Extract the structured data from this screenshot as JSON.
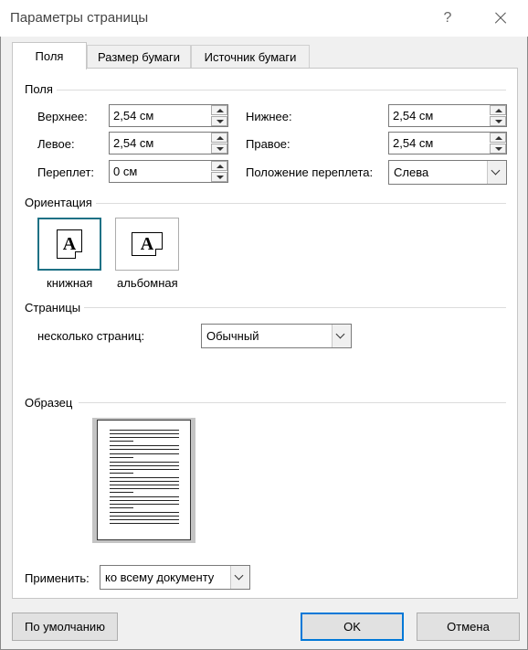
{
  "window": {
    "title": "Параметры страницы",
    "help": "?"
  },
  "tabs": [
    "Поля",
    "Размер бумаги",
    "Источник бумаги"
  ],
  "margins": {
    "group_label": "Поля",
    "top_label": "Верхнее:",
    "top_value": "2,54 см",
    "left_label": "Левое:",
    "left_value": "2,54 см",
    "gutter_label": "Переплет:",
    "gutter_value": "0 см",
    "bottom_label": "Нижнее:",
    "bottom_value": "2,54 см",
    "right_label": "Правое:",
    "right_value": "2,54 см",
    "gutter_pos_label": "Положение переплета:",
    "gutter_pos_value": "Слева"
  },
  "orientation": {
    "group_label": "Ориентация",
    "portrait_label": "книжная",
    "landscape_label": "альбомная",
    "icon_letter": "A",
    "selected": "portrait"
  },
  "pages": {
    "group_label": "Страницы",
    "multiple_label": "несколько страниц:",
    "multiple_value": "Обычный"
  },
  "preview": {
    "group_label": "Образец"
  },
  "apply": {
    "label": "Применить:",
    "value": "ко всему документу"
  },
  "buttons": {
    "default": "По умолчанию",
    "ok": "OK",
    "cancel": "Отмена"
  },
  "colors": {
    "accent": "#0078d7",
    "selected_border": "#1e7185"
  }
}
